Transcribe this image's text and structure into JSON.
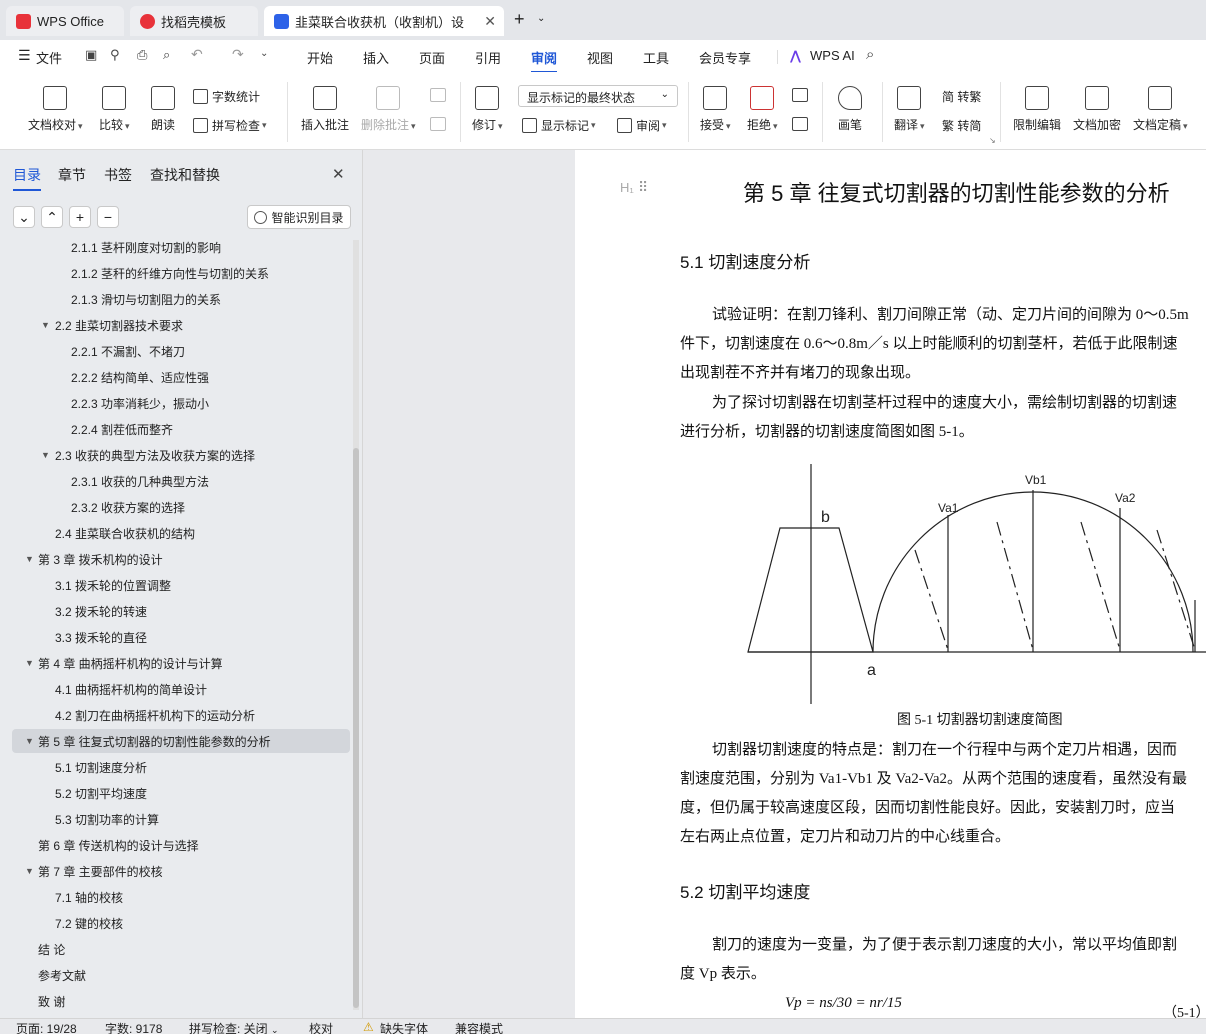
{
  "tabs": [
    {
      "label": "WPS Office",
      "color": "#e8323a"
    },
    {
      "label": "找稻壳模板",
      "color": "#e8323a"
    },
    {
      "label": "韭菜联合收获机（收割机）设",
      "color": "#2d62e8"
    }
  ],
  "new_tab": "+",
  "menu": {
    "file": "文件",
    "items": [
      "开始",
      "插入",
      "页面",
      "引用",
      "审阅",
      "视图",
      "工具",
      "会员专享"
    ],
    "active": "审阅",
    "ai": "WPS AI"
  },
  "ribbon": {
    "doc_check": "文档校对",
    "compare": "比较",
    "read_aloud": "朗读",
    "word_count": "字数统计",
    "spell_check": "拼写检查",
    "insert_comment": "插入批注",
    "delete_comment": "删除批注",
    "revise": "修订",
    "markup_state": "显示标记的最终状态",
    "show_markup": "显示标记",
    "review": "审阅",
    "accept": "接受",
    "reject": "拒绝",
    "pen": "画笔",
    "translate": "翻译",
    "to_traditional": "简 转繁",
    "to_simplified": "繁 转简",
    "restrict_edit": "限制编辑",
    "encrypt": "文档加密",
    "finalize": "文档定稿"
  },
  "panel": {
    "tabs": [
      "目录",
      "章节",
      "书签",
      "查找和替换"
    ],
    "smart_toc": "智能识别目录",
    "toc": [
      {
        "text": "2.1.1 茎杆刚度对切割的影响",
        "level": 3,
        "arrow": ""
      },
      {
        "text": "2.1.2 茎秆的纤维方向性与切割的关系",
        "level": 3,
        "arrow": ""
      },
      {
        "text": "2.1.3 滑切与切割阻力的关系",
        "level": 3,
        "arrow": ""
      },
      {
        "text": "2.2 韭菜切割器技术要求",
        "level": 2,
        "arrow": "▼"
      },
      {
        "text": "2.2.1 不漏割、不堵刀",
        "level": 3,
        "arrow": ""
      },
      {
        "text": "2.2.2 结构简单、适应性强",
        "level": 3,
        "arrow": ""
      },
      {
        "text": "2.2.3 功率消耗少，振动小",
        "level": 3,
        "arrow": ""
      },
      {
        "text": "2.2.4 割茬低而整齐",
        "level": 3,
        "arrow": ""
      },
      {
        "text": "2.3 收获的典型方法及收获方案的选择",
        "level": 2,
        "arrow": "▼"
      },
      {
        "text": "2.3.1 收获的几种典型方法",
        "level": 3,
        "arrow": ""
      },
      {
        "text": "2.3.2 收获方案的选择",
        "level": 3,
        "arrow": ""
      },
      {
        "text": "2.4 韭菜联合收获机的结构",
        "level": 2,
        "arrow": ""
      },
      {
        "text": "第 3 章  拨禾机构的设计",
        "level": 1,
        "arrow": "▼"
      },
      {
        "text": "3.1 拨禾轮的位置调整",
        "level": 2,
        "arrow": ""
      },
      {
        "text": "3.2 拨禾轮的转速",
        "level": 2,
        "arrow": ""
      },
      {
        "text": "3.3  拨禾轮的直径",
        "level": 2,
        "arrow": ""
      },
      {
        "text": "第 4 章  曲柄摇杆机构的设计与计算",
        "level": 1,
        "arrow": "▼"
      },
      {
        "text": "4.1 曲柄摇杆机构的简单设计",
        "level": 2,
        "arrow": ""
      },
      {
        "text": "4.2 割刀在曲柄摇杆机构下的运动分析",
        "level": 2,
        "arrow": ""
      },
      {
        "text": "第 5 章  往复式切割器的切割性能参数的分析",
        "level": 1,
        "arrow": "▼",
        "selected": true
      },
      {
        "text": "5.1 切割速度分析",
        "level": 2,
        "arrow": ""
      },
      {
        "text": "5.2 切割平均速度",
        "level": 2,
        "arrow": ""
      },
      {
        "text": "5.3 切割功率的计算",
        "level": 2,
        "arrow": ""
      },
      {
        "text": "第 6 章  传送机构的设计与选择",
        "level": 1,
        "arrow": ""
      },
      {
        "text": "第 7 章  主要部件的校核",
        "level": 1,
        "arrow": "▼"
      },
      {
        "text": "7.1 轴的校核",
        "level": 2,
        "arrow": ""
      },
      {
        "text": "7.2 键的校核",
        "level": 2,
        "arrow": ""
      },
      {
        "text": "结    论",
        "level": 1,
        "arrow": ""
      },
      {
        "text": "参考文献",
        "level": 1,
        "arrow": ""
      },
      {
        "text": "致    谢",
        "level": 1,
        "arrow": ""
      }
    ]
  },
  "doc": {
    "heading_marker": "H₁",
    "chapter_title": "第 5 章  往复式切割器的切割性能参数的分析",
    "s51": "5.1 切割速度分析",
    "p1_l1": "试验证明：在割刀锋利、割刀间隙正常（动、定刀片间的间隙为 0～0.5m",
    "p1_l2": "件下，切割速度在 0.6～0.8m／s 以上时能顺利的切割茎杆，若低于此限制速",
    "p1_l3": "出现割茬不齐并有堵刀的现象出现。",
    "p2_l1": "为了探讨切割器在切割茎杆过程中的速度大小，需绘制切割器的切割速",
    "p2_l2": "进行分析，切割器的切割速度简图如图 5-1。",
    "fig_labels": {
      "b": "b",
      "a": "a",
      "va1": "Va1",
      "vb1": "Vb1",
      "va2": "Va2"
    },
    "fig_caption": "图 5-1 切割器切割速度简图",
    "p3_l1": "切割器切割速度的特点是：割刀在一个行程中与两个定刀片相遇，因而",
    "p3_l2": "割速度范围，分别为 Va1-Vb1 及 Va2-Va2。从两个范围的速度看，虽然没有最",
    "p3_l3": "度，但仍属于较高速度区段，因而切割性能良好。因此，安装割刀时，应当",
    "p3_l4": "左右两止点位置，定刀片和动刀片的中心线重合。",
    "s52": "5.2 切割平均速度",
    "p4_l1": "割刀的速度为一变量，为了便于表示割刀速度的大小，常以平均值即割",
    "p4_l2": "度 Vp 表示。",
    "formula": "Vp = ns/30 = nr/15",
    "formula_no": "（5-1）"
  },
  "status": {
    "page": "页面: 19/28",
    "words": "字数: 9178",
    "spell": "拼写检查: 关闭",
    "proof": "校对",
    "missing_font": "缺失字体",
    "compat": "兼容模式"
  }
}
